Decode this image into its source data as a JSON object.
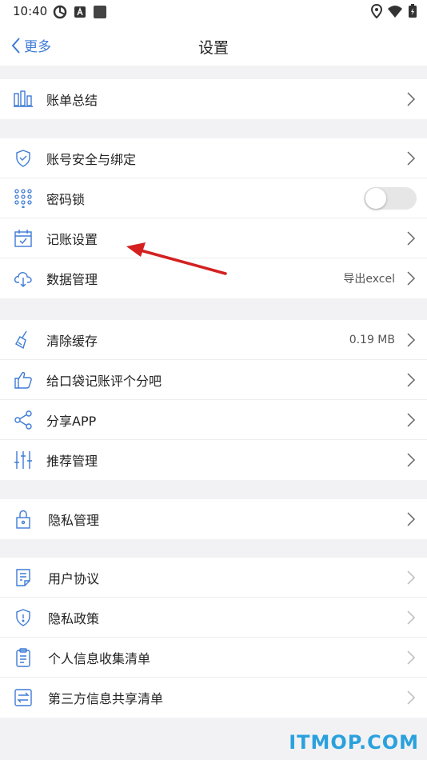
{
  "status_bar": {
    "time": "10:40"
  },
  "nav": {
    "back_label": "更多",
    "title": "设置"
  },
  "groups": [
    {
      "items": [
        {
          "label": "账单总结",
          "icon": "bar-chart-icon"
        }
      ]
    },
    {
      "items": [
        {
          "label": "账号安全与绑定",
          "icon": "shield-check-icon"
        },
        {
          "label": "密码锁",
          "icon": "keypad-icon",
          "toggle": false
        },
        {
          "label": "记账设置",
          "icon": "calendar-check-icon"
        },
        {
          "label": "数据管理",
          "icon": "cloud-download-icon",
          "value": "导出excel"
        }
      ]
    },
    {
      "items": [
        {
          "label": "清除缓存",
          "icon": "broom-icon",
          "value": "0.19 MB"
        },
        {
          "label": "给口袋记账评个分吧",
          "icon": "thumbs-up-icon"
        },
        {
          "label": "分享APP",
          "icon": "share-icon"
        },
        {
          "label": "推荐管理",
          "icon": "sliders-icon"
        }
      ]
    },
    {
      "items": [
        {
          "label": "隐私管理",
          "icon": "lock-icon"
        }
      ]
    },
    {
      "items": [
        {
          "label": "用户协议",
          "icon": "document-icon"
        },
        {
          "label": "隐私政策",
          "icon": "shield-info-icon"
        },
        {
          "label": "个人信息收集清单",
          "icon": "clipboard-icon"
        },
        {
          "label": "第三方信息共享清单",
          "icon": "exchange-icon"
        }
      ]
    }
  ],
  "watermark": "ITMOP.COM",
  "colors": {
    "accent": "#3e7bd6",
    "arrow": "#d42020",
    "watermark": "#2aa1dd"
  }
}
